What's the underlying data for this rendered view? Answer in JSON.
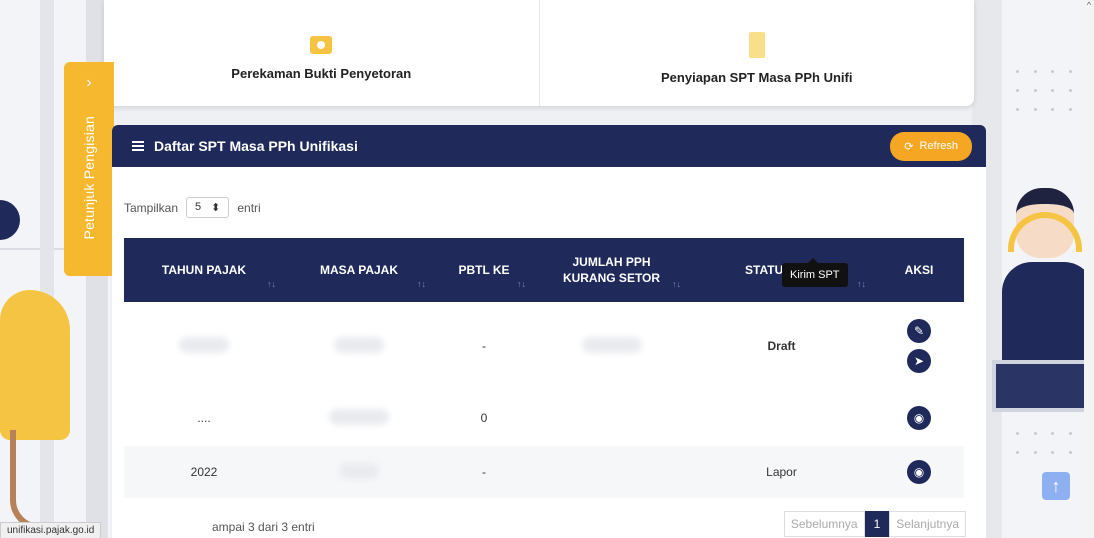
{
  "cards": [
    {
      "label": "Perekaman Bukti Penyetoran",
      "icon": "money-icon"
    },
    {
      "label": "Penyiapan SPT Masa PPh Unifi",
      "icon": "document-icon"
    }
  ],
  "sidebar_tab": {
    "label": "Petunjuk Pengisian",
    "chevron": "›"
  },
  "panel": {
    "title": "Daftar SPT Masa PPh Unifikasi",
    "refresh_label": "Refresh",
    "refresh_icon": "⟳",
    "show_prefix": "Tampilkan",
    "show_value": "5",
    "show_suffix": "entri"
  },
  "table": {
    "headers": [
      "TAHUN PAJAK",
      "MASA PAJAK",
      "PBTL KE",
      "JUMLAH PPH KURANG SETOR",
      "STATUS SPT",
      "AKSI"
    ],
    "sort_icon": "↑↓",
    "rows": [
      {
        "tahun": "",
        "masa": "",
        "pbtl": "-",
        "jumlah": "",
        "status": "Draft"
      },
      {
        "tahun": "....",
        "masa": "",
        "pbtl": "0",
        "jumlah": "",
        "status": ""
      },
      {
        "tahun": "2022",
        "masa": "",
        "pbtl": "-",
        "jumlah": "",
        "status": "Lapor"
      }
    ]
  },
  "tooltip": "Kirim SPT",
  "footer": {
    "info": "ampai 3 dari 3 entri",
    "prev": "Sebelumnya",
    "page": "1",
    "next": "Selanjutnya"
  },
  "status_url": "unifikasi.pajak.go.id",
  "colors": {
    "navy": "#1f2a5a",
    "accent": "#f5a623",
    "yellow": "#f5c443"
  }
}
